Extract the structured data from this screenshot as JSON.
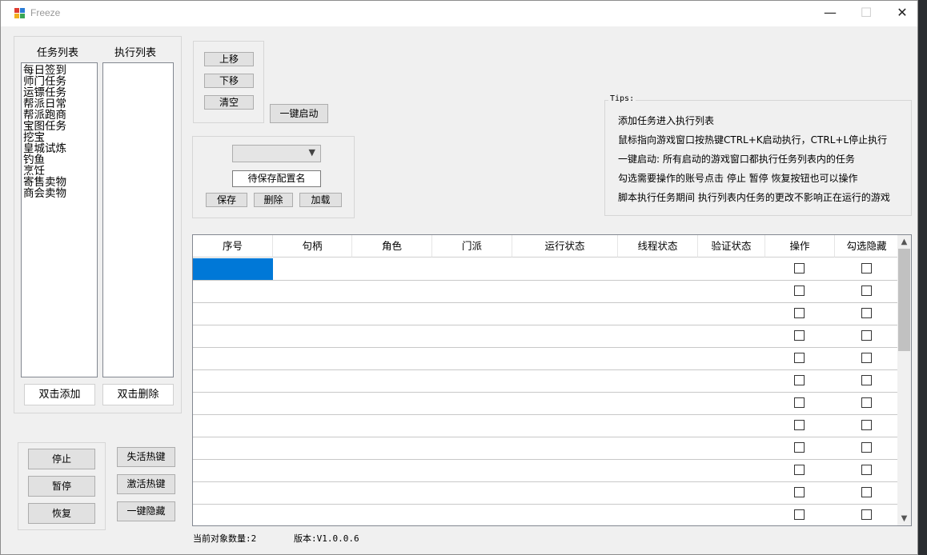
{
  "window": {
    "title": "Freeze",
    "minimize": "—",
    "maximize": "☐",
    "close": "✕"
  },
  "task_panel": {
    "task_list_header": "任务列表",
    "exec_list_header": "执行列表",
    "tasks": [
      "每日签到",
      "师门任务",
      "运镖任务",
      "帮派日常",
      "帮派跑商",
      "宝图任务",
      "挖宝",
      "皇城试炼",
      "钓鱼",
      "烹饪",
      "寄售卖物",
      "商会卖物"
    ],
    "add_button": "双击添加",
    "remove_button": "双击删除"
  },
  "order_panel": {
    "up": "上移",
    "down": "下移",
    "clear": "清空"
  },
  "one_key_start": "一键启动",
  "config_panel": {
    "combo_value": "",
    "config_name": "待保存配置名",
    "save": "保存",
    "delete": "删除",
    "load": "加载"
  },
  "tips": {
    "legend": "Tips:",
    "lines": [
      "添加任务进入执行列表",
      "鼠标指向游戏窗口按热键CTRL+K启动执行，CTRL+L停止执行",
      "一键启动: 所有启动的游戏窗口都执行任务列表内的任务",
      "勾选需要操作的账号点击 停止 暂停 恢复按钮也可以操作",
      "脚本执行任务期间 执行列表内任务的更改不影响正在运行的游戏"
    ]
  },
  "control_panel": {
    "stop": "停止",
    "pause": "暂停",
    "resume": "恢复"
  },
  "hotkeys": {
    "deactivate": "失活热键",
    "activate": "激活热键",
    "hide_all": "一键隐藏"
  },
  "grid": {
    "columns": [
      "序号",
      "句柄",
      "角色",
      "门派",
      "运行状态",
      "线程状态",
      "验证状态",
      "操作",
      "勾选隐藏"
    ],
    "row_count": 12
  },
  "status_bar": {
    "object_count": "当前对象数量:2",
    "version": "版本:V1.0.0.6"
  },
  "colors": {
    "selection": "#0078d7",
    "window_bg": "#f0f0f0"
  }
}
